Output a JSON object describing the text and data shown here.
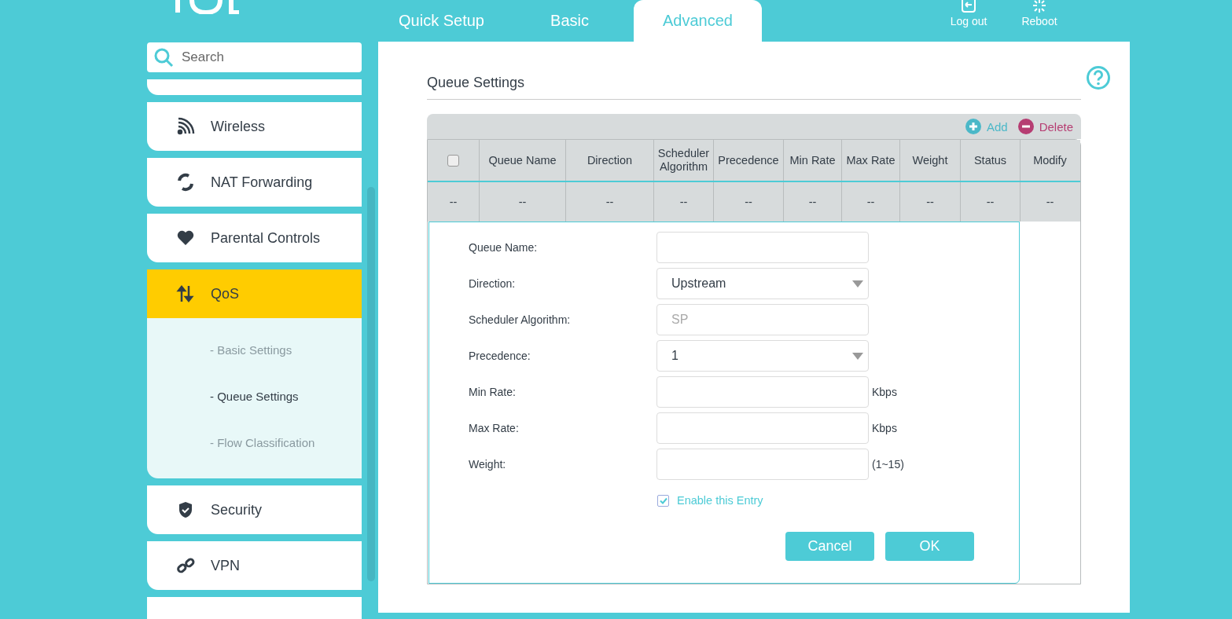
{
  "header": {
    "tabs": [
      {
        "label": "Quick Setup",
        "selected": false
      },
      {
        "label": "Basic",
        "selected": false
      },
      {
        "label": "Advanced",
        "selected": true
      }
    ],
    "actions": [
      {
        "kind": "logout",
        "label": "Log out"
      },
      {
        "kind": "reboot",
        "label": "Reboot"
      }
    ]
  },
  "sidebar": {
    "search": {
      "placeholder": "Search"
    },
    "items": [
      {
        "kind": "wireless",
        "label": "Wireless",
        "selected": false
      },
      {
        "kind": "nat",
        "label": "NAT Forwarding",
        "selected": false
      },
      {
        "kind": "parental",
        "label": "Parental Controls",
        "selected": false
      },
      {
        "kind": "qos",
        "label": "QoS",
        "selected": true,
        "expanded": true,
        "children": [
          {
            "label": "- Basic Settings",
            "selected": false
          },
          {
            "label": "- Queue Settings",
            "selected": true
          },
          {
            "label": "- Flow Classification",
            "selected": false
          }
        ]
      },
      {
        "kind": "security",
        "label": "Security",
        "selected": false
      },
      {
        "kind": "vpn",
        "label": "VPN",
        "selected": false
      }
    ]
  },
  "content": {
    "title": "Queue Settings",
    "toolbar": [
      {
        "kind": "add",
        "label": "Add"
      },
      {
        "kind": "delete",
        "label": "Delete"
      }
    ],
    "table": {
      "select_all_checked": false,
      "columns": [
        "",
        "Queue Name",
        "Direction",
        "Scheduler Algorithm",
        "Precedence",
        "Min Rate",
        "Max Rate",
        "Weight",
        "Status",
        "Modify"
      ],
      "rows": [
        [
          "--",
          "--",
          "--",
          "--",
          "--",
          "--",
          "--",
          "--",
          "--",
          "--"
        ]
      ]
    },
    "form": {
      "fields": [
        {
          "kind": "text",
          "label": "Queue Name:"
        },
        {
          "kind": "select",
          "label": "Direction:",
          "value": "Upstream"
        },
        {
          "kind": "readonly",
          "label": "Scheduler Algorithm:",
          "placeholder": "SP"
        },
        {
          "kind": "select",
          "label": "Precedence:",
          "value": "1"
        },
        {
          "kind": "text",
          "label": "Min Rate:",
          "unit": "Kbps"
        },
        {
          "kind": "text",
          "label": "Max Rate:",
          "unit": "Kbps"
        },
        {
          "kind": "text",
          "label": "Weight:",
          "unit": "(1~15)"
        }
      ],
      "enable": {
        "label": "Enable this Entry",
        "checked": true
      },
      "buttons": [
        "Cancel",
        "OK"
      ]
    }
  }
}
